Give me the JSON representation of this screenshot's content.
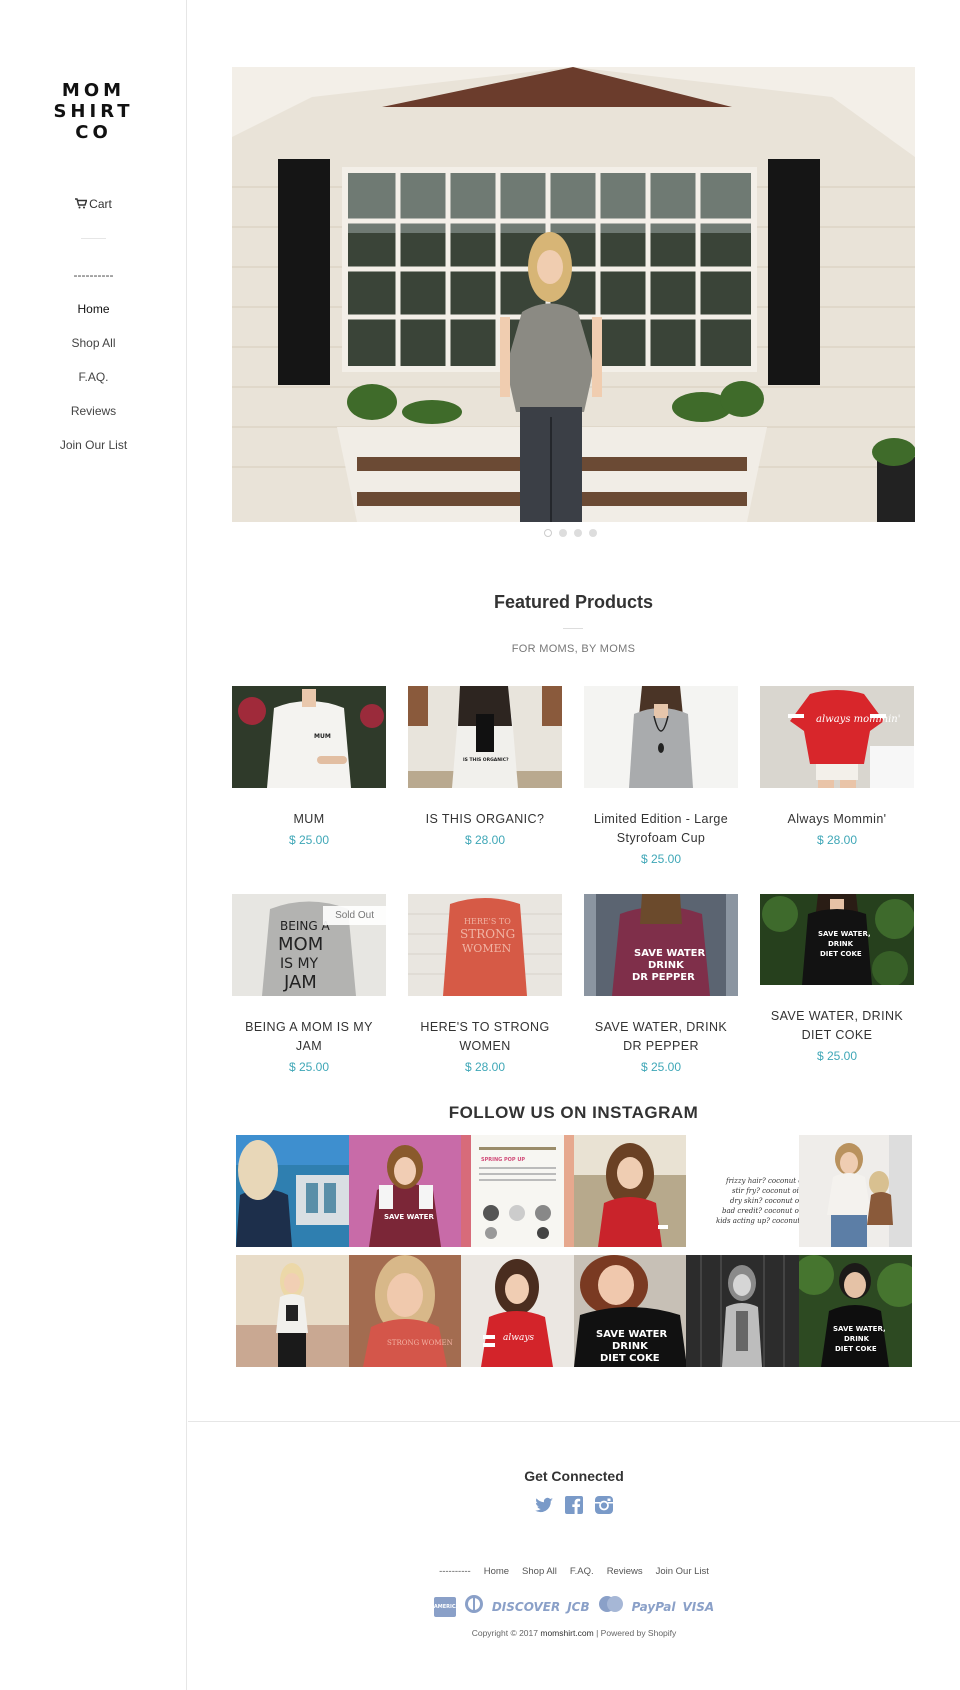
{
  "brand": {
    "logo_lines": [
      "MOM",
      "SHIRT",
      "CO"
    ]
  },
  "sidebar": {
    "cart_label": "Cart",
    "cart_icon": "cart-icon",
    "nav": [
      {
        "label": "----------"
      },
      {
        "label": "Home"
      },
      {
        "label": "Shop All"
      },
      {
        "label": "F.AQ."
      },
      {
        "label": "Reviews"
      },
      {
        "label": "Join Our List"
      }
    ]
  },
  "hero": {
    "slide_count": 4,
    "active_slide": 1
  },
  "featured": {
    "title": "Featured Products",
    "subtitle": "FOR MOMS, BY MOMS",
    "products": [
      {
        "name": "MUM",
        "price": "$ 25.00"
      },
      {
        "name": "IS THIS ORGANIC?",
        "price": "$ 28.00"
      },
      {
        "name": "Limited Edition - Large Styrofoam Cup",
        "price": "$ 25.00"
      },
      {
        "name": "Always Mommin'",
        "price": "$ 28.00"
      },
      {
        "name": "BEING A MOM IS MY JAM",
        "price": "$ 25.00",
        "badge": "Sold Out"
      },
      {
        "name": "HERE'S TO STRONG WOMEN",
        "price": "$ 28.00"
      },
      {
        "name": "SAVE WATER, DRINK DR PEPPER",
        "price": "$ 25.00"
      },
      {
        "name": "SAVE WATER, DRINK DIET COKE",
        "price": "$ 25.00"
      }
    ],
    "shirt_texts": [
      "MUM",
      "IS THIS ORGANIC?",
      "",
      "always mommin'",
      "BEING A MOM IS MY JAM",
      "HERE'S TO STRONG WOMEN",
      "SAVE WATER DRINK DR PEPPER",
      "SAVE WATER DRINK DIET COKE"
    ]
  },
  "instagram": {
    "title": "FOLLOW US ON INSTAGRAM",
    "tile_texts": [
      "",
      "SAVE WATER DRINK DR PEPPER",
      "SPRING POP UP + EASTER EGG HUNT",
      "",
      "frizzy hair? coconut oil",
      "",
      "",
      "STRONG WOMEN",
      "always mommin'",
      "SAVE WATER DRINK DIET COKE",
      "",
      "SAVE WATER DRINK DIET COKE"
    ]
  },
  "footer": {
    "connect_title": "Get Connected",
    "social_icons": [
      "twitter-icon",
      "facebook-icon",
      "instagram-icon"
    ],
    "nav": [
      "----------",
      "Home",
      "Shop All",
      "F.AQ.",
      "Reviews",
      "Join Our List"
    ],
    "payments": [
      "AMERICAN EXPRESS",
      "Diners",
      "DISCOVER",
      "JCB",
      "MasterCard",
      "PayPal",
      "VISA"
    ],
    "copyright_prefix": "Copyright © 2017",
    "copyright_site": "momshirt.com",
    "copyright_suffix": "| Powered by Shopify"
  },
  "colors": {
    "price": "#3fa7b7",
    "payment_icons": "#8aa0c8",
    "border": "#e6e6e6"
  }
}
